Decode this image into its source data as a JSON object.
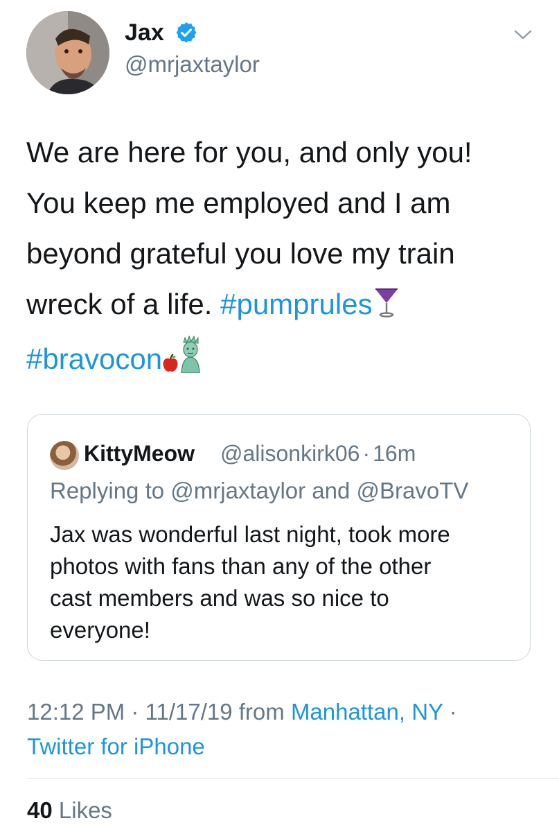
{
  "author": {
    "display_name": "Jax",
    "handle": "@mrjaxtaylor",
    "verified": true
  },
  "tweet": {
    "lines": [
      "We are here for you, and only you!",
      "You keep me employed and I am",
      "beyond grateful you love my train"
    ],
    "line4_text": "wreck of a life. ",
    "hashtag_1": "#pumprules",
    "hashtag_2": "#bravocon",
    "emojis": [
      "cocktail-glass",
      "red-apple",
      "statue-of-liberty"
    ]
  },
  "quoted_tweet": {
    "display_name": "KittyMeow",
    "handle": "@alisonkirk06",
    "separator": "·",
    "time_ago": "16m",
    "replying_to": "Replying to @mrjaxtaylor and @BravoTV",
    "text_lines": [
      "Jax was wonderful last night, took more",
      "photos with fans than any of the other",
      "cast members and was so nice to",
      "everyone!"
    ]
  },
  "meta": {
    "time": "12:12 PM",
    "separator": " · ",
    "date": "11/17/19",
    "from_label": " from ",
    "location": "Manhattan, NY",
    "trailing_separator": " ·",
    "source": "Twitter for iPhone"
  },
  "engagement": {
    "likes_count": "40",
    "likes_label": " Likes"
  },
  "colors": {
    "link_blue": "#1b95e0",
    "secondary_gray": "#657786",
    "text_dark": "#14171a",
    "border": "#ccd6dd"
  }
}
